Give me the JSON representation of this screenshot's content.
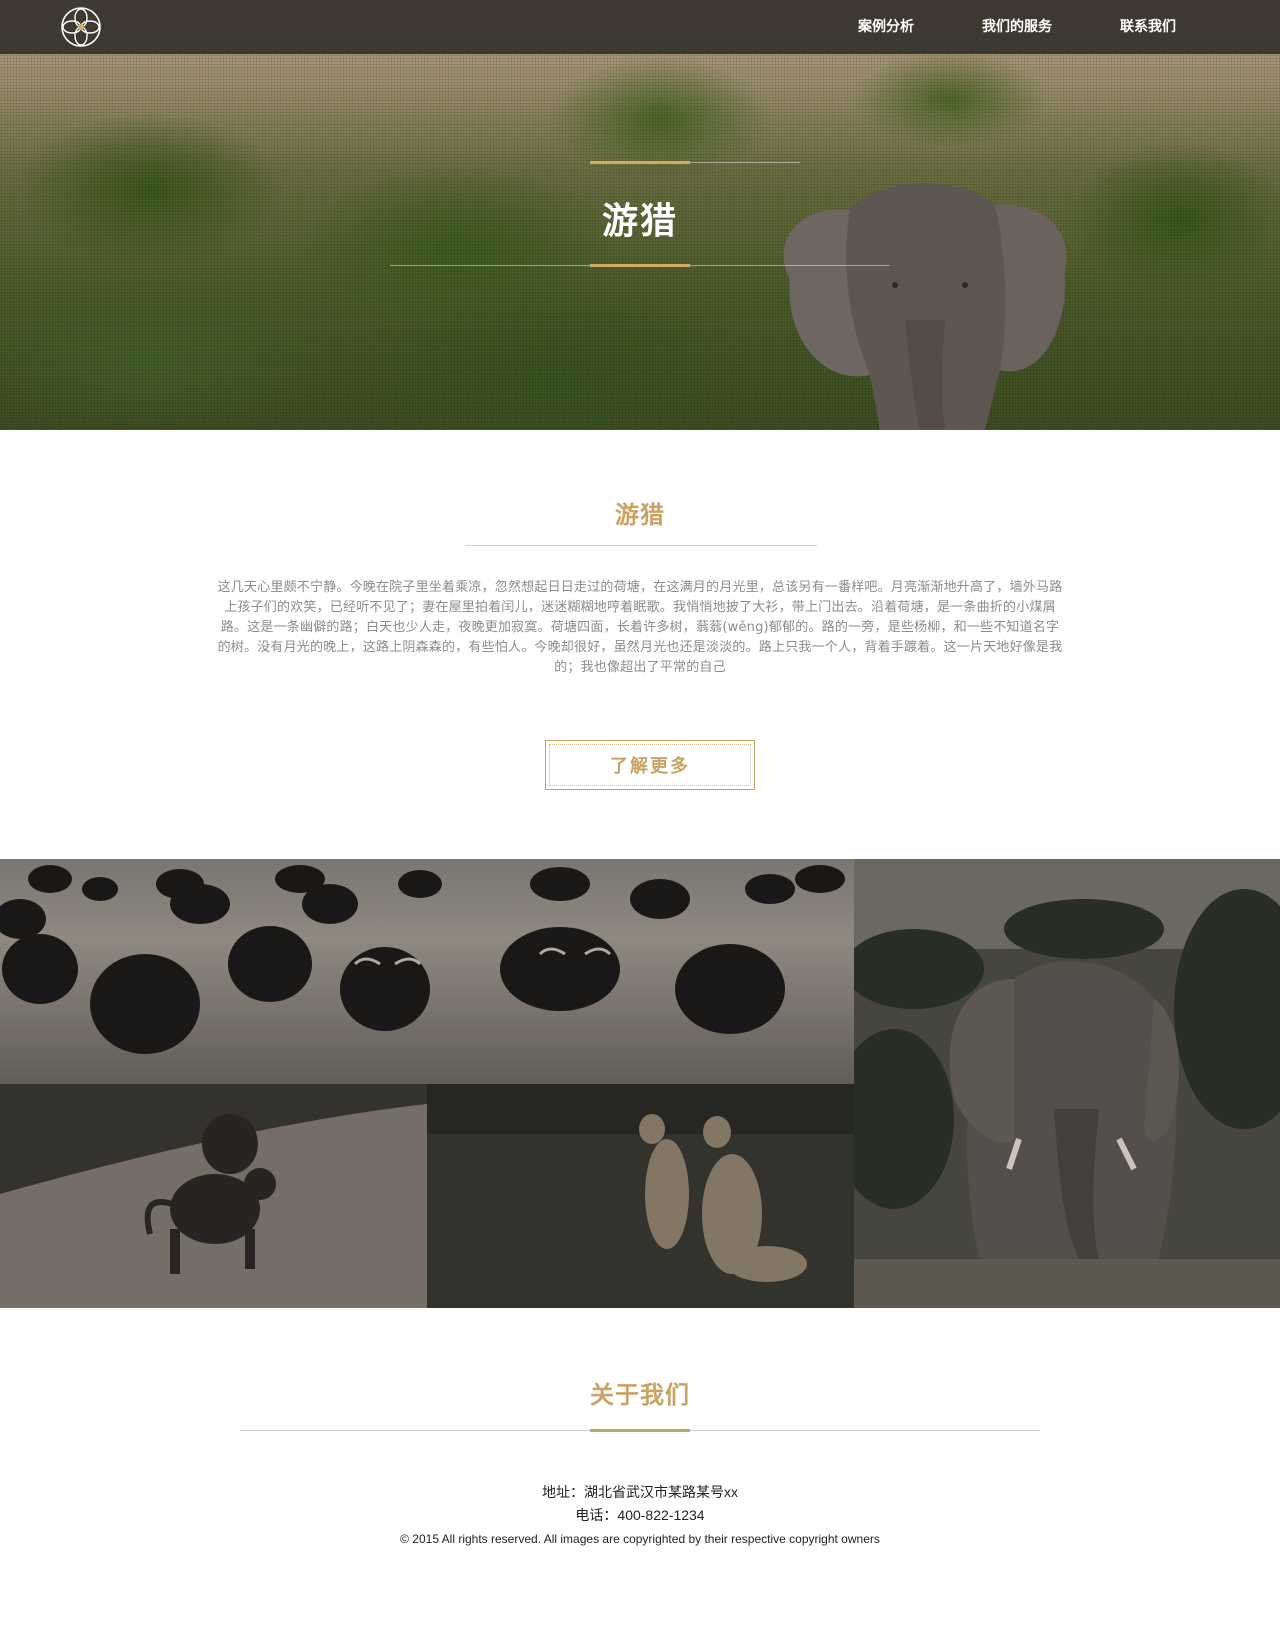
{
  "nav": {
    "logo_icon": "flower-logo-icon",
    "items": [
      {
        "label": "案例分析"
      },
      {
        "label": "我们的服务"
      },
      {
        "label": "联系我们"
      }
    ]
  },
  "hero": {
    "title": "游猎"
  },
  "intro": {
    "title": "游猎",
    "body": "这几天心里颇不宁静。今晚在院子里坐着乘凉，忽然想起日日走过的荷塘，在这满月的月光里，总该另有一番样吧。月亮渐渐地升高了，墙外马路上孩子们的欢笑，已经听不见了；妻在屋里拍着闰儿，迷迷糊糊地哼着眠歌。我悄悄地披了大衫，带上门出去。沿着荷塘，是一条曲折的小煤屑路。这是一条幽僻的路；白天也少人走，夜晚更加寂寞。荷塘四面，长着许多树，蓊蓊(wěng)郁郁的。路的一旁，是些杨柳，和一些不知道名字的树。没有月光的晚上，这路上阴森森的，有些怕人。今晚却很好，虽然月光也还是淡淡的。路上只我一个人，背着手踱着。这一片天地好像是我的；我也像超出了平常的自己",
    "button_label": "了解更多"
  },
  "gallery": {
    "images": [
      "buffalo-herd-photo",
      "baboons-photo",
      "lionesses-photo",
      "elephant-photo"
    ]
  },
  "about": {
    "title": "关于我们",
    "address": "地址：湖北省武汉市某路某号xx",
    "phone": "电话：400-822-1234",
    "copyright": "© 2015 All rights reserved. All images are copyrighted by their respective copyright owners"
  },
  "colors": {
    "accent": "#c9a265",
    "body_text": "#8c8c8c",
    "nav_bg": "#2d2b28"
  }
}
